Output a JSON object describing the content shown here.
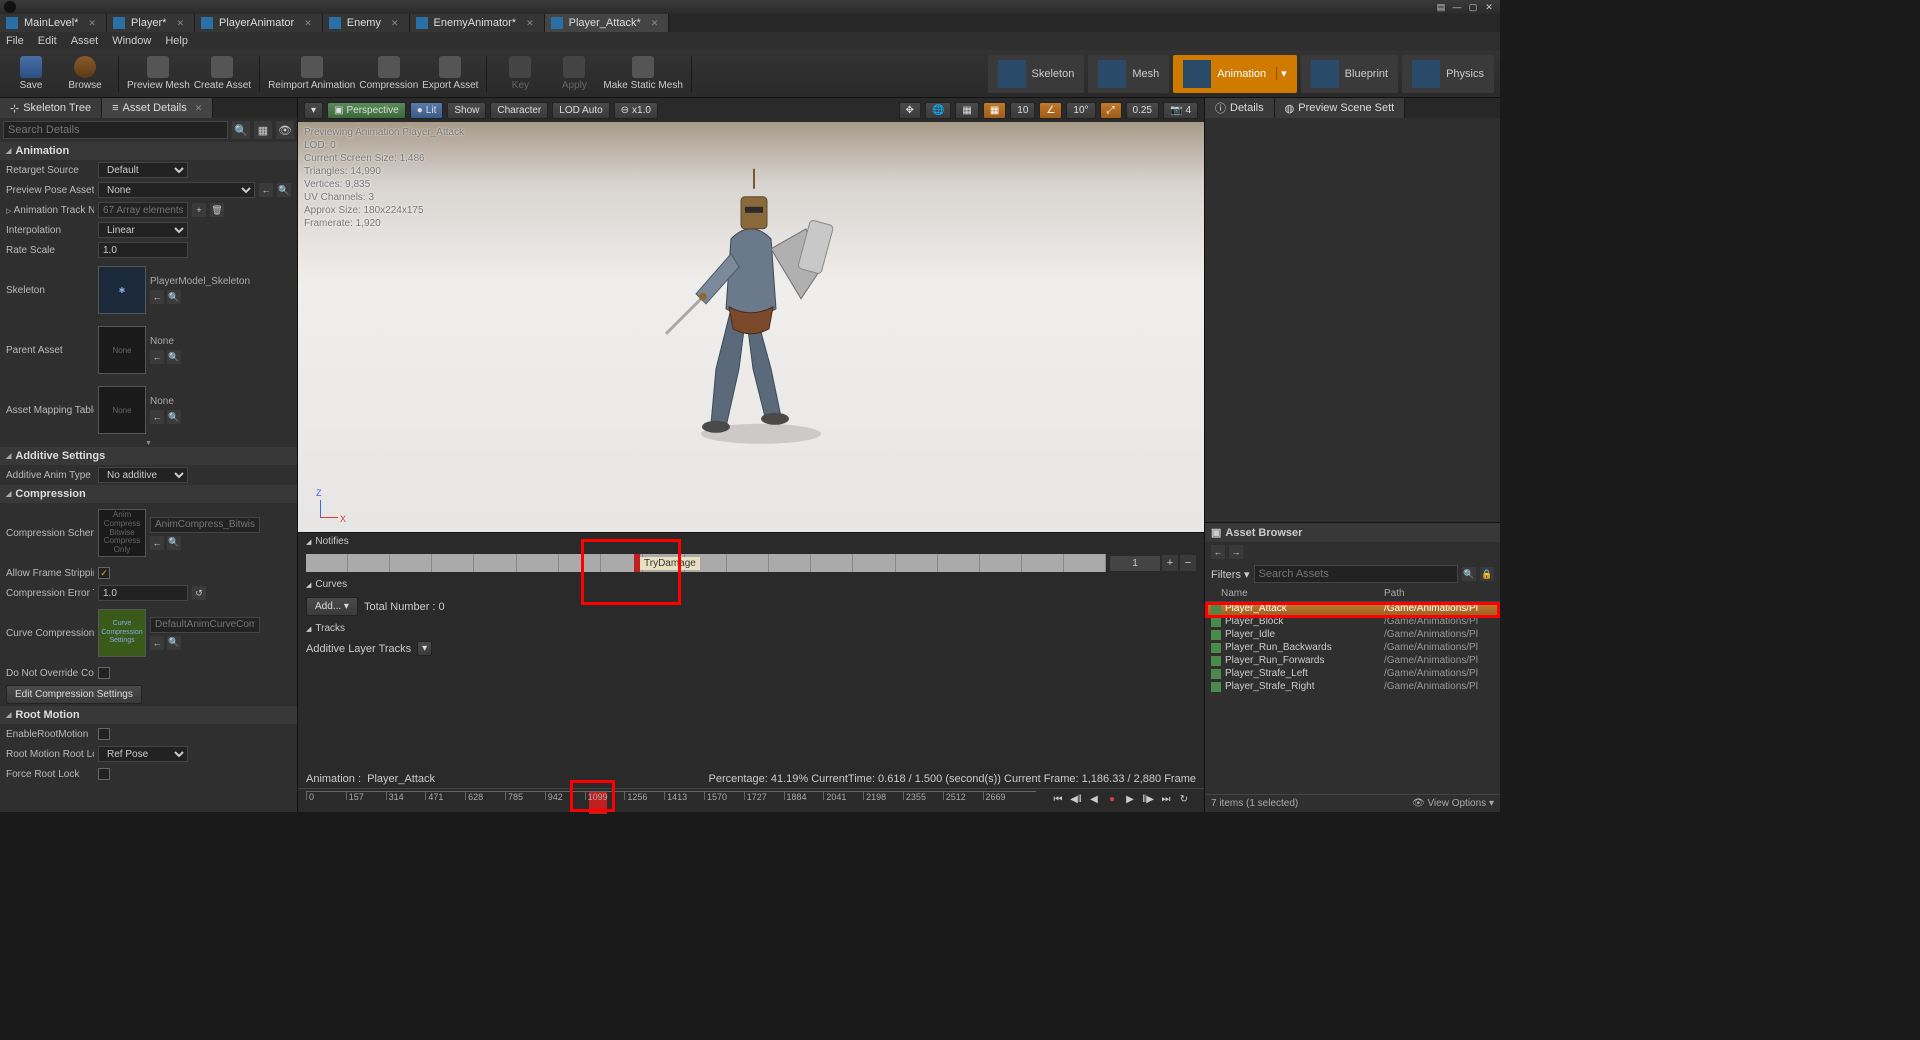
{
  "titlebar": {
    "icons": [
      "ue"
    ]
  },
  "doc_tabs": [
    {
      "label": "MainLevel*",
      "active": false
    },
    {
      "label": "Player*",
      "active": false
    },
    {
      "label": "PlayerAnimator",
      "active": false
    },
    {
      "label": "Enemy",
      "active": false
    },
    {
      "label": "EnemyAnimator*",
      "active": false
    },
    {
      "label": "Player_Attack*",
      "active": true
    }
  ],
  "menu": [
    "File",
    "Edit",
    "Asset",
    "Window",
    "Help"
  ],
  "toolbar": {
    "left": [
      {
        "id": "save",
        "label": "Save"
      },
      {
        "id": "browse",
        "label": "Browse"
      },
      {
        "id": "preview-mesh",
        "label": "Preview Mesh",
        "dd": true
      },
      {
        "id": "create-asset",
        "label": "Create Asset",
        "dd": true
      },
      {
        "id": "reimport",
        "label": "Reimport Animation"
      },
      {
        "id": "compression",
        "label": "Compression"
      },
      {
        "id": "export",
        "label": "Export Asset",
        "dd": true
      },
      {
        "id": "key",
        "label": "Key",
        "disabled": true
      },
      {
        "id": "apply",
        "label": "Apply",
        "disabled": true
      },
      {
        "id": "make-static",
        "label": "Make Static Mesh"
      }
    ],
    "modes": [
      {
        "id": "skeleton",
        "label": "Skeleton"
      },
      {
        "id": "mesh",
        "label": "Mesh"
      },
      {
        "id": "animation",
        "label": "Animation",
        "active": true,
        "dd": true
      },
      {
        "id": "blueprint",
        "label": "Blueprint"
      },
      {
        "id": "physics",
        "label": "Physics"
      }
    ]
  },
  "left_panel": {
    "tabs": [
      "Skeleton Tree",
      "Asset Details"
    ],
    "active_tab": 1,
    "search_ph": "Search Details",
    "sections": {
      "animation": {
        "title": "Animation",
        "retarget_source_lbl": "Retarget Source",
        "retarget_source": "Default",
        "preview_pose_lbl": "Preview Pose Asset",
        "preview_pose": "None",
        "track_names_lbl": "Animation Track Nam",
        "track_names_ph": "67 Array elements",
        "interp_lbl": "Interpolation",
        "interp": "Linear",
        "rate_lbl": "Rate Scale",
        "rate": "1.0",
        "skeleton_lbl": "Skeleton",
        "skeleton_asset": "PlayerModel_Skeleton",
        "parent_lbl": "Parent Asset",
        "parent_asset": "None",
        "parent_thumb": "None",
        "mapping_lbl": "Asset Mapping Table",
        "mapping_asset": "None",
        "mapping_thumb": "None"
      },
      "additive": {
        "title": "Additive Settings",
        "type_lbl": "Additive Anim Type",
        "type": "No additive"
      },
      "compression": {
        "title": "Compression",
        "scheme_lbl": "Compression Schem",
        "scheme_thumb": "Anim\nCompress\nBitwise\nCompress\nOnly",
        "scheme_asset_ph": "AnimCompress_BitwiseC",
        "allow_strip_lbl": "Allow Frame Strippin",
        "allow_strip": true,
        "err_thresh_lbl": "Compression Error Th",
        "err_thresh": "1.0",
        "curve_lbl": "Curve Compression S",
        "curve_thumb": "Curve\nCompression\nSettings",
        "curve_asset_ph": "DefaultAnimCurveCompre",
        "override_lbl": "Do Not Override Com",
        "override": false,
        "edit_btn": "Edit Compression Settings"
      },
      "root_motion": {
        "title": "Root Motion",
        "enable_lbl": "EnableRootMotion",
        "enable": false,
        "lock_lbl": "Root Motion Root Loc",
        "lock": "Ref Pose",
        "force_lbl": "Force Root Lock",
        "force": false
      }
    }
  },
  "viewport": {
    "btns": {
      "persp": "Perspective",
      "lit": "Lit",
      "show": "Show",
      "char": "Character",
      "lod": "LOD Auto",
      "speed": "x1.0"
    },
    "right_vals": [
      "10",
      "10°",
      "0.25",
      "4"
    ],
    "info": [
      "Previewing Animation Player_Attack",
      "LOD: 0",
      "Current Screen Size: 1.486",
      "Triangles: 14,990",
      "Vertices: 9,835",
      "UV Channels: 3",
      "Approx Size: 180x224x175",
      "Framerate: 1,920"
    ]
  },
  "lower": {
    "notifies_lbl": "Notifies",
    "notify_event": "TryDamage",
    "notify_track_num": "1",
    "curves_lbl": "Curves",
    "add_btn": "Add...",
    "total_lbl": "Total Number : 0",
    "tracks_lbl": "Tracks",
    "additive_layer_lbl": "Additive Layer Tracks",
    "anim_name_lbl": "Animation :",
    "anim_name": "Player_Attack",
    "percentage": "Percentage: 41.19% CurrentTime: 0.618 / 1.500 (second(s)) Current Frame: 1,186.33 / 2,880 Frame",
    "ticks": [
      "0",
      "157",
      "314",
      "471",
      "628",
      "785",
      "942",
      "1099",
      "1256",
      "1413",
      "1570",
      "1727",
      "1884",
      "2041",
      "2198",
      "2355",
      "2512",
      "2669"
    ]
  },
  "right_panel": {
    "tabs": [
      "Details",
      "Preview Scene Sett"
    ],
    "asset_browser": {
      "title": "Asset Browser",
      "filters": "Filters",
      "search_ph": "Search Assets",
      "col_name": "Name",
      "col_path": "Path",
      "items": [
        {
          "name": "Player_Attack",
          "path": "/Game/Animations/Pl",
          "sel": true
        },
        {
          "name": "Player_Block",
          "path": "/Game/Animations/Pl"
        },
        {
          "name": "Player_Idle",
          "path": "/Game/Animations/Pl"
        },
        {
          "name": "Player_Run_Backwards",
          "path": "/Game/Animations/Pl"
        },
        {
          "name": "Player_Run_Forwards",
          "path": "/Game/Animations/Pl"
        },
        {
          "name": "Player_Strafe_Left",
          "path": "/Game/Animations/Pl"
        },
        {
          "name": "Player_Strafe_Right",
          "path": "/Game/Animations/Pl"
        }
      ],
      "footer_count": "7 items (1 selected)",
      "view_options": "View Options"
    }
  }
}
